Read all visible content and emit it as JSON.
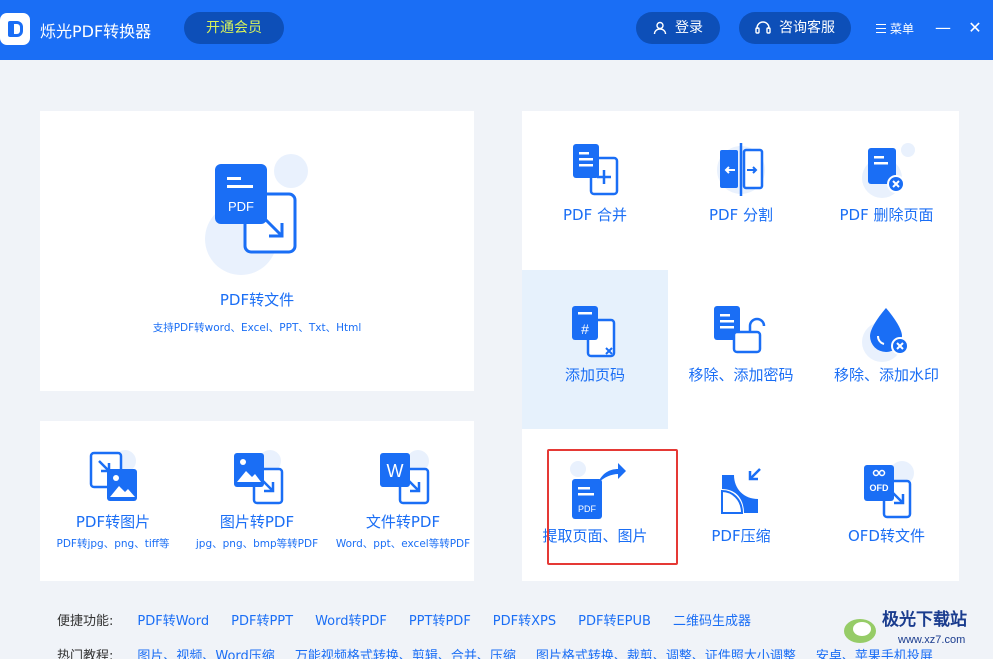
{
  "header": {
    "title": "烁光PDF转换器",
    "vip_label": "开通会员",
    "login_label": "登录",
    "service_label": "咨询客服",
    "menu_label": "菜单",
    "minimize": "—",
    "close": "✕"
  },
  "main_tool": {
    "label": "PDF转文件",
    "sub": "支持PDF转word、Excel、PPT、Txt、Html",
    "icon_text": "PDF"
  },
  "small_tools": [
    {
      "label": "PDF转图片",
      "sub": "PDF转jpg、png、tiff等"
    },
    {
      "label": "图片转PDF",
      "sub": "jpg、png、bmp等转PDF"
    },
    {
      "label": "文件转PDF",
      "sub": "Word、ppt、excel等转PDF",
      "icon_text": "W"
    }
  ],
  "grid_tools": [
    {
      "label": "PDF 合并"
    },
    {
      "label": "PDF 分割"
    },
    {
      "label": "PDF 删除页面"
    },
    {
      "label": "添加页码",
      "icon_text": "#"
    },
    {
      "label": "移除、添加密码"
    },
    {
      "label": "移除、添加水印"
    },
    {
      "label": "提取页面、图片",
      "icon_text": "PDF"
    },
    {
      "label": "PDF压缩"
    },
    {
      "label": "OFD转文件",
      "icon_text": "OFD"
    }
  ],
  "quick": {
    "title": "便捷功能:",
    "links": [
      "PDF转Word",
      "PDF转PPT",
      "Word转PDF",
      "PPT转PDF",
      "PDF转XPS",
      "PDF转EPUB",
      "二维码生成器"
    ]
  },
  "tutorials": {
    "title": "热门教程:",
    "links": [
      "图片、视频、Word压缩",
      "万能视频格式转换、剪辑、合并、压缩",
      "图片格式转换、裁剪、调整、证件照大小调整",
      "安卓、苹果手机投屏"
    ]
  },
  "watermark": {
    "text": "极光下载站",
    "url": "www.xz7.com"
  },
  "colors": {
    "brand": "#1a6ef5",
    "highlight": "#e6f1fc",
    "selection": "#e53935"
  }
}
